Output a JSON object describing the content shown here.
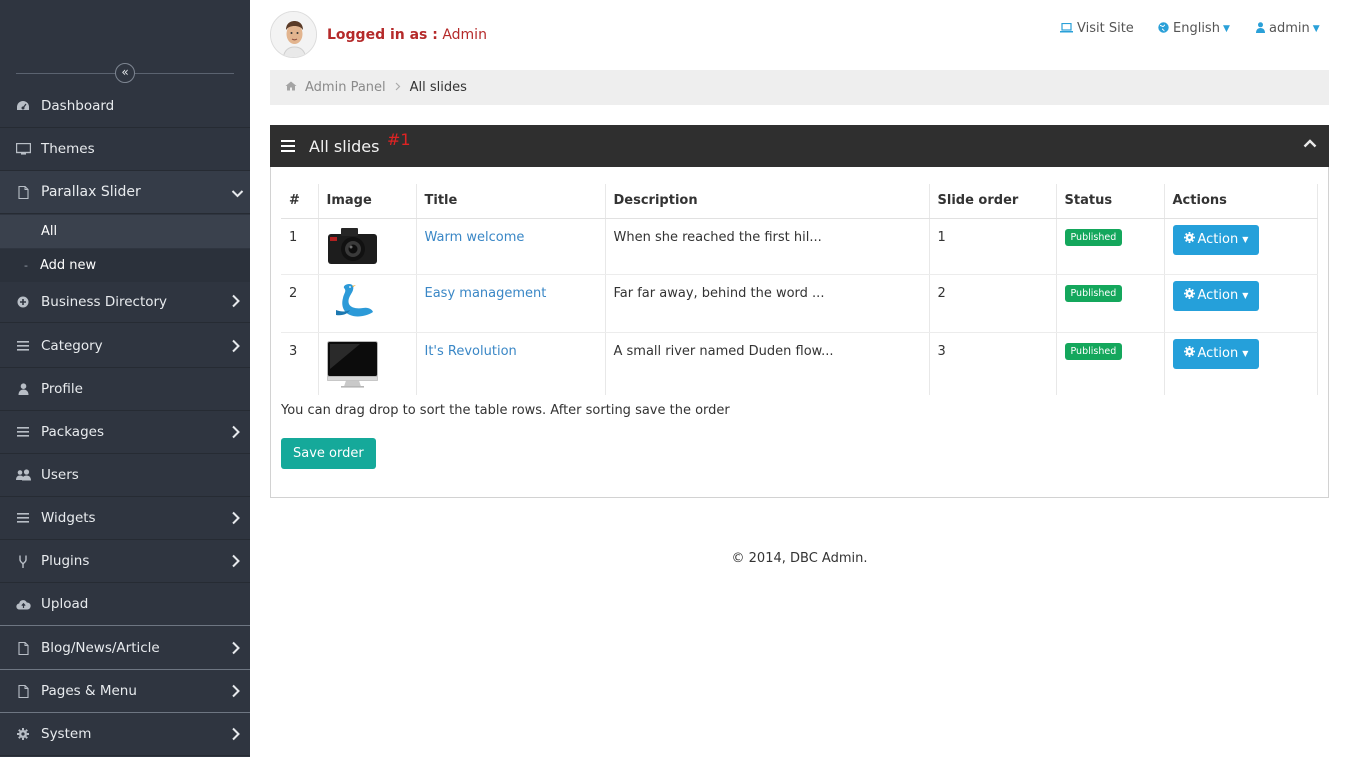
{
  "sidebar": {
    "collapse_glyph": "«",
    "items": [
      {
        "label": "Dashboard",
        "icon": "dashboard-icon",
        "chevron": ""
      },
      {
        "label": "Themes",
        "icon": "monitor-icon",
        "chevron": ""
      },
      {
        "label": "Parallax Slider",
        "icon": "file-icon",
        "chevron": "down"
      },
      {
        "label": "Business Directory",
        "icon": "plus-circle-icon",
        "chevron": "right"
      },
      {
        "label": "Category",
        "icon": "list-icon",
        "chevron": "right"
      },
      {
        "label": "Profile",
        "icon": "user-icon",
        "chevron": ""
      },
      {
        "label": "Packages",
        "icon": "list-icon",
        "chevron": "right"
      },
      {
        "label": "Users",
        "icon": "users-icon",
        "chevron": ""
      },
      {
        "label": "Widgets",
        "icon": "list-icon",
        "chevron": "right"
      },
      {
        "label": "Plugins",
        "icon": "plug-icon",
        "chevron": "right"
      },
      {
        "label": "Upload",
        "icon": "cloud-upload-icon",
        "chevron": ""
      },
      {
        "label": "Blog/News/Article",
        "icon": "file-icon",
        "chevron": "right"
      },
      {
        "label": "Pages & Menu",
        "icon": "file-icon",
        "chevron": "right"
      },
      {
        "label": "System",
        "icon": "gear-icon",
        "chevron": "right"
      }
    ],
    "sub": {
      "all_label": "All",
      "add_new_label": "Add new",
      "add_new_prefix": "-"
    }
  },
  "header": {
    "logged_in_label": "Logged in as :",
    "logged_in_user": "Admin",
    "visit_site": "Visit Site",
    "language": "English",
    "user_menu": "admin"
  },
  "breadcrumb": {
    "root": "Admin Panel",
    "current": "All slides"
  },
  "panel": {
    "title": "All slides",
    "number": "#1"
  },
  "table": {
    "columns": [
      "#",
      "Image",
      "Title",
      "Description",
      "Slide order",
      "Status",
      "Actions"
    ],
    "rows": [
      {
        "num": "1",
        "image": "camera-thumbnail",
        "title": "Warm welcome",
        "description": "When she reached the first hil...",
        "order": "1",
        "status": "Published",
        "action": "Action"
      },
      {
        "num": "2",
        "image": "bird-thumbnail",
        "title": "Easy management",
        "description": "Far far away, behind the word ...",
        "order": "2",
        "status": "Published",
        "action": "Action"
      },
      {
        "num": "3",
        "image": "monitor-thumbnail",
        "title": "It's Revolution",
        "description": "A small river named Duden flow...",
        "order": "3",
        "status": "Published",
        "action": "Action"
      }
    ]
  },
  "drag_note": "You can drag drop to sort the table rows. After sorting save the order",
  "save_order_label": "Save order",
  "footer": "© 2014, DBC Admin.",
  "colors": {
    "sidebar_bg": "#2f3540",
    "panel_header_bg": "#2f2f2f",
    "accent_blue": "#25a0da",
    "save_green": "#15a99a",
    "published_green": "#14a75c",
    "login_red": "#b52a2a"
  }
}
